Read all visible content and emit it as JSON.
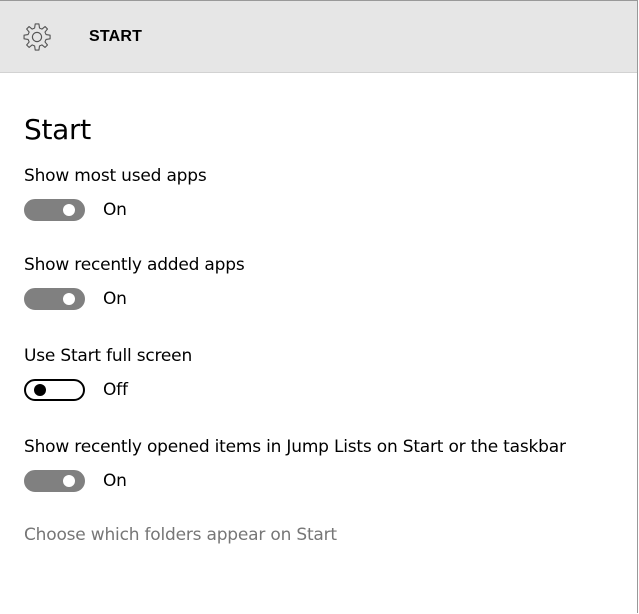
{
  "header": {
    "title": "START",
    "icon": "gear-icon"
  },
  "page": {
    "heading": "Start"
  },
  "settings": [
    {
      "label": "Show most used apps",
      "state": "On",
      "on": true
    },
    {
      "label": "Show recently added apps",
      "state": "On",
      "on": true
    },
    {
      "label": "Use Start full screen",
      "state": "Off",
      "on": false
    },
    {
      "label": "Show recently opened items in Jump Lists on Start or the taskbar",
      "state": "On",
      "on": true
    }
  ],
  "link": {
    "label": "Choose which folders appear on Start"
  },
  "colors": {
    "header_bg": "#e6e6e6",
    "toggle_on": "#808080",
    "toggle_off_border": "#000000",
    "link": "#767676"
  }
}
